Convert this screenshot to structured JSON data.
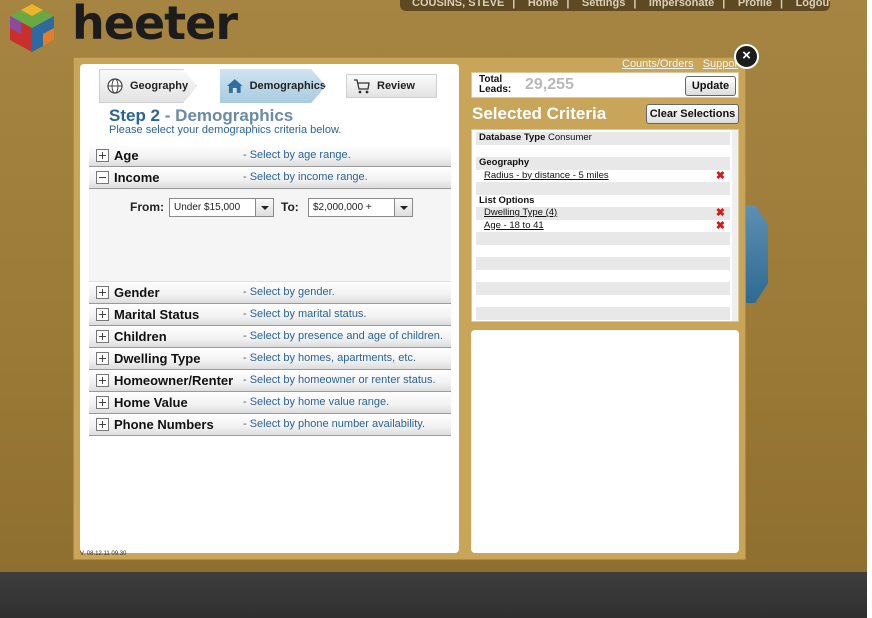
{
  "app": {
    "logo_text": "heeter",
    "nav": [
      "COUSINS, STEVE",
      "Home",
      "Settings",
      "Impersonate",
      "Profile",
      "Logout"
    ],
    "version": "V. 08.12.11 09.30"
  },
  "wizard": {
    "steps": [
      "Geography",
      "Demographics",
      "Review"
    ],
    "active_step": "Demographics",
    "step_number": "Step 2",
    "step_separator": "-",
    "step_name": "Demographics",
    "subtitle": "Please select your demographics criteria below."
  },
  "criteria": [
    {
      "label": "Age",
      "desc": "- Select by age range.",
      "expanded": false
    },
    {
      "label": "Income",
      "desc": "- Select by income range.",
      "expanded": true
    },
    {
      "label": "Gender",
      "desc": "- Select by gender.",
      "expanded": false
    },
    {
      "label": "Marital Status",
      "desc": "- Select by marital status.",
      "expanded": false
    },
    {
      "label": "Children",
      "desc": "- Select by presence and age of children.",
      "expanded": false
    },
    {
      "label": "Dwelling Type",
      "desc": "- Select by homes, apartments, etc.",
      "expanded": false
    },
    {
      "label": "Homeowner/Renter",
      "desc": "- Select by homeowner or renter status.",
      "expanded": false
    },
    {
      "label": "Home Value",
      "desc": "- Select by home value range.",
      "expanded": false
    },
    {
      "label": "Phone Numbers",
      "desc": "- Select by phone number availability.",
      "expanded": false
    }
  ],
  "income": {
    "from_label": "From:",
    "from_value": "Under $15,000",
    "to_label": "To:",
    "to_value": "$2,000,000 +"
  },
  "summary": {
    "total_leads_label_1": "Total",
    "total_leads_label_2": "Leads:",
    "total_leads": "29,255",
    "update_label": "Update",
    "links": [
      "Counts/Orders",
      "Suppor"
    ],
    "close_glyph": "×",
    "title": "Selected Criteria",
    "clear_label": "Clear Selections",
    "database_type_label": "Database Type",
    "database_type_value": "Consumer",
    "geography_header": "Geography",
    "geography_items": [
      "Radius - by distance - 5 miles"
    ],
    "list_options_header": "List Options",
    "list_options_items": [
      "Dwelling Type (4)",
      "Age - 18 to 41"
    ],
    "remove_glyph": "✖"
  },
  "colors": {
    "background": "#9c7a36",
    "frame": "#c9a55a",
    "accent_blue": "#2a6496",
    "remove_red": "#d01b1b"
  },
  "icons": {
    "geography": "globe-icon",
    "demographics": "house-icon",
    "review": "cart-icon"
  }
}
